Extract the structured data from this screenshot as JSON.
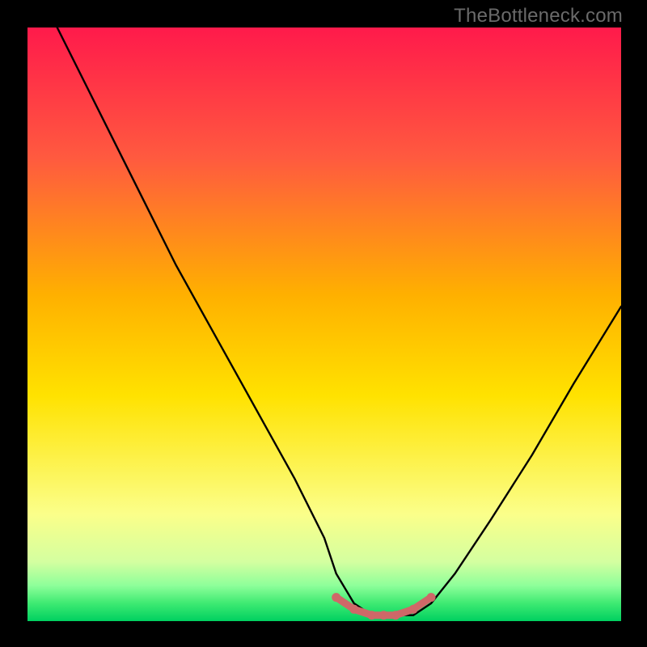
{
  "watermark": {
    "text": "TheBottleneck.com"
  },
  "chart_data": {
    "type": "line",
    "title": "",
    "xlabel": "",
    "ylabel": "",
    "xlim": [
      0,
      100
    ],
    "ylim": [
      0,
      100
    ],
    "grid": false,
    "legend": false,
    "gradient_colors": {
      "top": "#ff1a4b",
      "upper_mid": "#ff7a3a",
      "mid": "#ffd200",
      "lower_mid": "#f8ff6a",
      "green_band": "#2ee86b",
      "bottom": "#00d060"
    },
    "series": [
      {
        "name": "bottleneck-curve",
        "color": "#000000",
        "x": [
          5,
          10,
          15,
          20,
          25,
          30,
          35,
          40,
          45,
          50,
          52,
          55,
          58,
          62,
          65,
          68,
          72,
          78,
          85,
          92,
          100
        ],
        "y": [
          100,
          90,
          80,
          70,
          60,
          51,
          42,
          33,
          24,
          14,
          8,
          3,
          1,
          1,
          1,
          3,
          8,
          17,
          28,
          40,
          53
        ]
      },
      {
        "name": "valley-highlight",
        "color": "#d46a6a",
        "x": [
          52,
          55,
          58,
          60,
          62,
          65,
          68
        ],
        "y": [
          4,
          2,
          1,
          1,
          1,
          2,
          4
        ]
      }
    ]
  }
}
